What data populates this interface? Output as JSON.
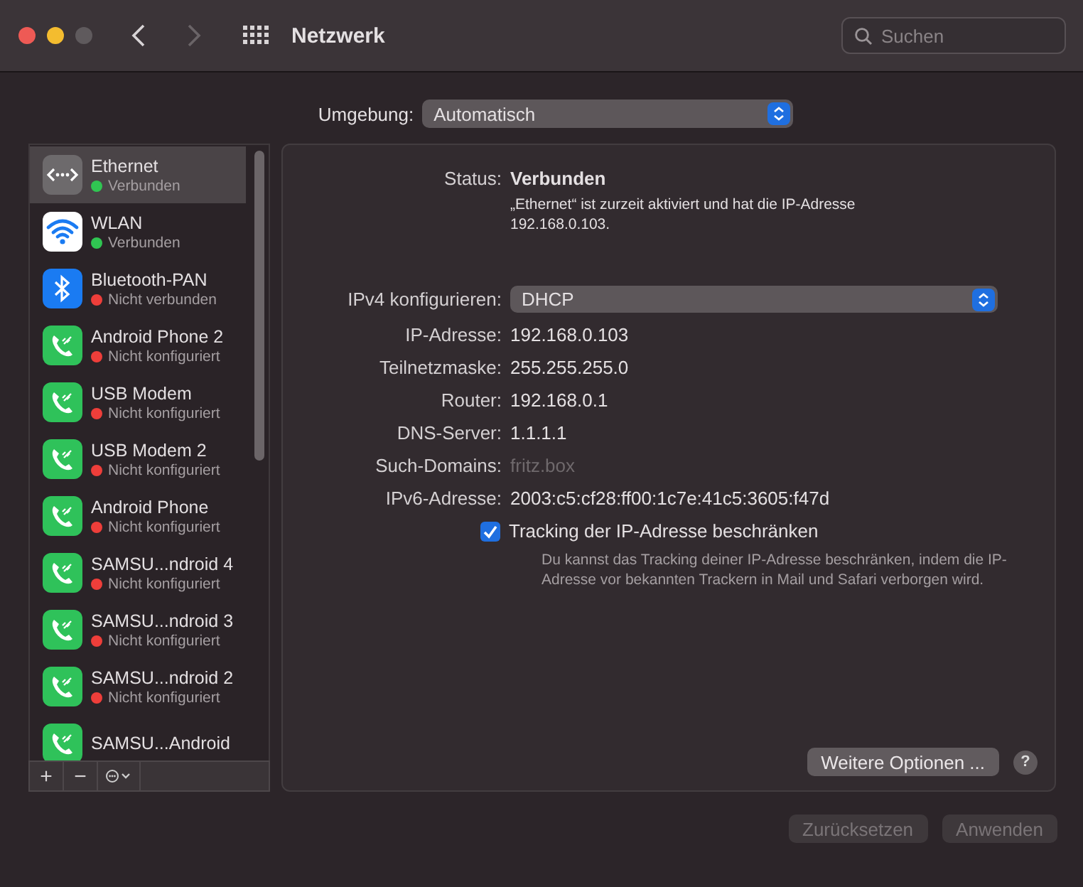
{
  "window": {
    "title": "Netzwerk"
  },
  "search": {
    "placeholder": "Suchen"
  },
  "location": {
    "label": "Umgebung:",
    "value": "Automatisch"
  },
  "services": [
    {
      "name": "Ethernet",
      "kind": "ethernet",
      "status": "Verbunden",
      "color": "#30c552",
      "selected": true
    },
    {
      "name": "WLAN",
      "kind": "wifi",
      "status": "Verbunden",
      "color": "#30c552",
      "selected": false
    },
    {
      "name": "Bluetooth-PAN",
      "kind": "bluetooth",
      "status": "Nicht verbunden",
      "color": "#ee3e3a",
      "selected": false
    },
    {
      "name": "Android Phone 2",
      "kind": "phone",
      "status": "Nicht konfiguriert",
      "color": "#ee3e3a",
      "selected": false
    },
    {
      "name": "USB Modem",
      "kind": "phone",
      "status": "Nicht konfiguriert",
      "color": "#ee3e3a",
      "selected": false
    },
    {
      "name": "USB Modem 2",
      "kind": "phone",
      "status": "Nicht konfiguriert",
      "color": "#ee3e3a",
      "selected": false
    },
    {
      "name": "Android Phone",
      "kind": "phone",
      "status": "Nicht konfiguriert",
      "color": "#ee3e3a",
      "selected": false
    },
    {
      "name": "SAMSU...ndroid 4",
      "kind": "phone",
      "status": "Nicht konfiguriert",
      "color": "#ee3e3a",
      "selected": false
    },
    {
      "name": "SAMSU...ndroid 3",
      "kind": "phone",
      "status": "Nicht konfiguriert",
      "color": "#ee3e3a",
      "selected": false
    },
    {
      "name": "SAMSU...ndroid 2",
      "kind": "phone",
      "status": "Nicht konfiguriert",
      "color": "#ee3e3a",
      "selected": false
    },
    {
      "name": "SAMSU...Android",
      "kind": "phone",
      "selected": false
    }
  ],
  "list_toolbar": {
    "add": "+",
    "remove": "−"
  },
  "detail": {
    "status": {
      "label": "Status:",
      "value": "Verbunden",
      "description": "„Ethernet“ ist zurzeit aktiviert und hat die IP-Adresse 192.168.0.103."
    },
    "ipv4": {
      "label": "IPv4 konfigurieren:",
      "value": "DHCP"
    },
    "fields": [
      {
        "label": "IP-Adresse:",
        "value": "192.168.0.103",
        "disabled": false
      },
      {
        "label": "Teilnetzmaske:",
        "value": "255.255.255.0",
        "disabled": false
      },
      {
        "label": "Router:",
        "value": "192.168.0.1",
        "disabled": false
      },
      {
        "label": "DNS-Server:",
        "value": "1.1.1.1",
        "disabled": false
      },
      {
        "label": "Such-Domains:",
        "value": "fritz.box",
        "disabled": true
      },
      {
        "label": "IPv6-Adresse:",
        "value": "2003:c5:cf28:ff00:1c7e:41c5:3605:f47d",
        "disabled": false
      }
    ],
    "tracking": {
      "label": "Tracking der IP-Adresse beschränken",
      "checked": true,
      "description": "Du kannst das Tracking deiner IP-Adresse beschränken, indem die IP-Adresse vor bekannten Trackern in Mail und Safari verborgen wird."
    },
    "more_button": "Weitere Optionen ...",
    "help": "?"
  },
  "buttons": [
    {
      "label": "Zurücksetzen",
      "disabled": true
    },
    {
      "label": "Anwenden",
      "disabled": true
    }
  ]
}
